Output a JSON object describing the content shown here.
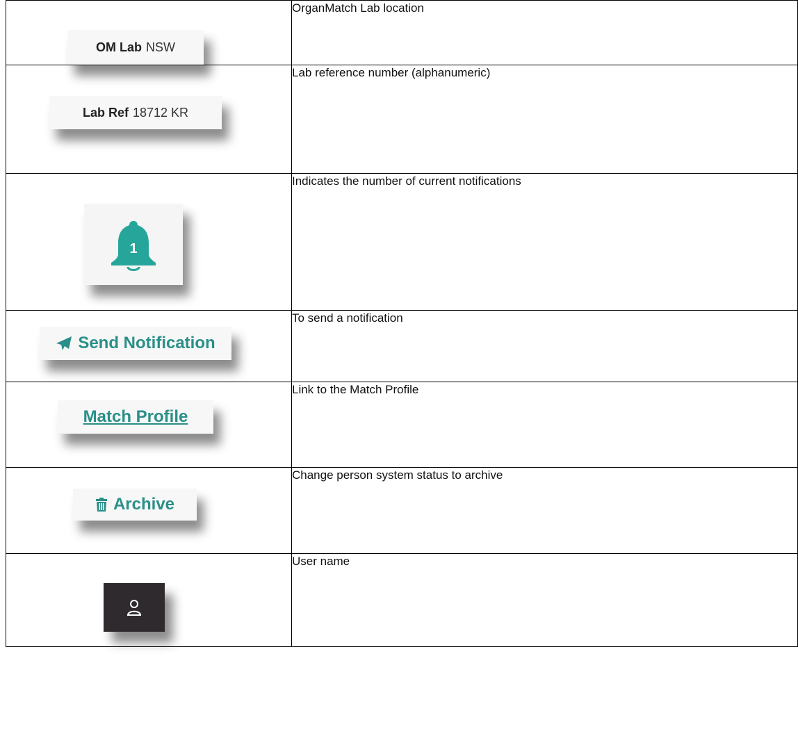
{
  "rows": [
    {
      "chip": {
        "bold": "OM Lab",
        "plain": "NSW"
      },
      "description": "OrganMatch Lab location"
    },
    {
      "chip": {
        "bold": "Lab Ref",
        "plain": "18712 KR"
      },
      "description": "Lab reference number (alphanumeric)"
    },
    {
      "chip": {
        "icon": "bell-icon",
        "badge": "1"
      },
      "description": "Indicates the number of current notifications"
    },
    {
      "chip": {
        "icon": "paper-plane-icon",
        "label": "Send Notification"
      },
      "description": "To send a notification"
    },
    {
      "chip": {
        "label": "Match Profile"
      },
      "description": "Link to the Match Profile"
    },
    {
      "chip": {
        "icon": "trash-icon",
        "label": "Archive"
      },
      "description": "Change person system status to archive"
    },
    {
      "chip": {
        "icon": "user-icon"
      },
      "description": "User name"
    }
  ],
  "colors": {
    "accent": "#2a8f88",
    "bell": "#26a69a",
    "user_bg": "#2e2a2d"
  }
}
